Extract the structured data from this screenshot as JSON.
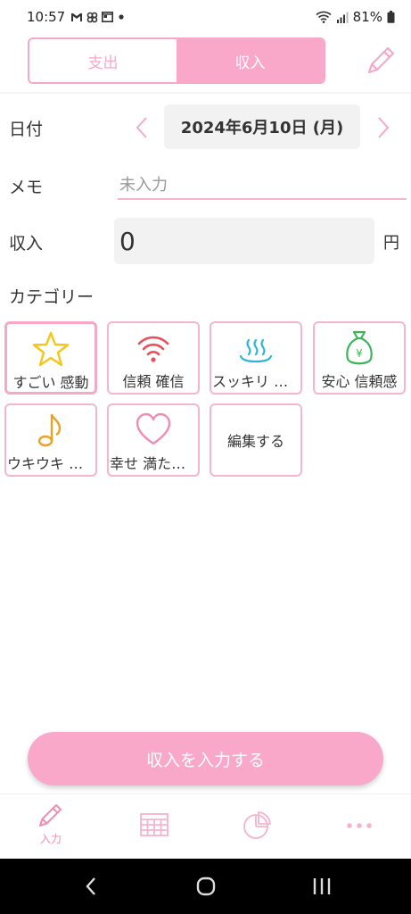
{
  "status_bar": {
    "time": "10:57",
    "battery": "81%",
    "icons": [
      "gmail-icon",
      "fan-icon",
      "calendar-icon",
      "dot-icon",
      "wifi-icon",
      "signal-icon",
      "battery-icon"
    ]
  },
  "header": {
    "tabs": [
      {
        "label": "支出",
        "selected": false
      },
      {
        "label": "収入",
        "selected": true
      }
    ],
    "edit_icon": "pencil-icon"
  },
  "form": {
    "date_label": "日付",
    "date_value": "2024年6月10日 (月)",
    "memo_label": "メモ",
    "memo_placeholder": "未入力",
    "amount_label": "収入",
    "amount_value": "0",
    "amount_unit": "円",
    "category_label": "カテゴリー"
  },
  "categories": [
    {
      "label": "すごい 感動",
      "icon": "star-icon",
      "selected": true
    },
    {
      "label": "信頼 確信",
      "icon": "wifi-icon",
      "selected": false
    },
    {
      "label": "スッキリ 爽快",
      "icon": "hot-spring-icon",
      "selected": false
    },
    {
      "label": "安心 信頼感",
      "icon": "money-bag-icon",
      "selected": false
    },
    {
      "label": "ウキウキ 楽しい",
      "icon": "music-note-icon",
      "selected": false
    },
    {
      "label": "幸せ 満たされる",
      "icon": "heart-icon",
      "selected": false
    },
    {
      "label": "編集する",
      "icon": "",
      "selected": false
    }
  ],
  "submit_label": "収入を入力する",
  "tabbar": {
    "items": [
      {
        "label": "入力",
        "icon": "pencil-icon",
        "active": true
      },
      {
        "label": "",
        "icon": "calendar-icon",
        "active": false
      },
      {
        "label": "",
        "icon": "pie-chart-icon",
        "active": false
      },
      {
        "label": "",
        "icon": "more-icon",
        "active": false
      }
    ]
  },
  "colors": {
    "accent": "#f9a8c9",
    "accent_border": "#f4b6cf",
    "star": "#f5c518",
    "wifi": "#e8505b",
    "hot_spring": "#29b6d6",
    "money_bag": "#3bb558",
    "music_note": "#f0a020",
    "heart": "#f08db4"
  }
}
